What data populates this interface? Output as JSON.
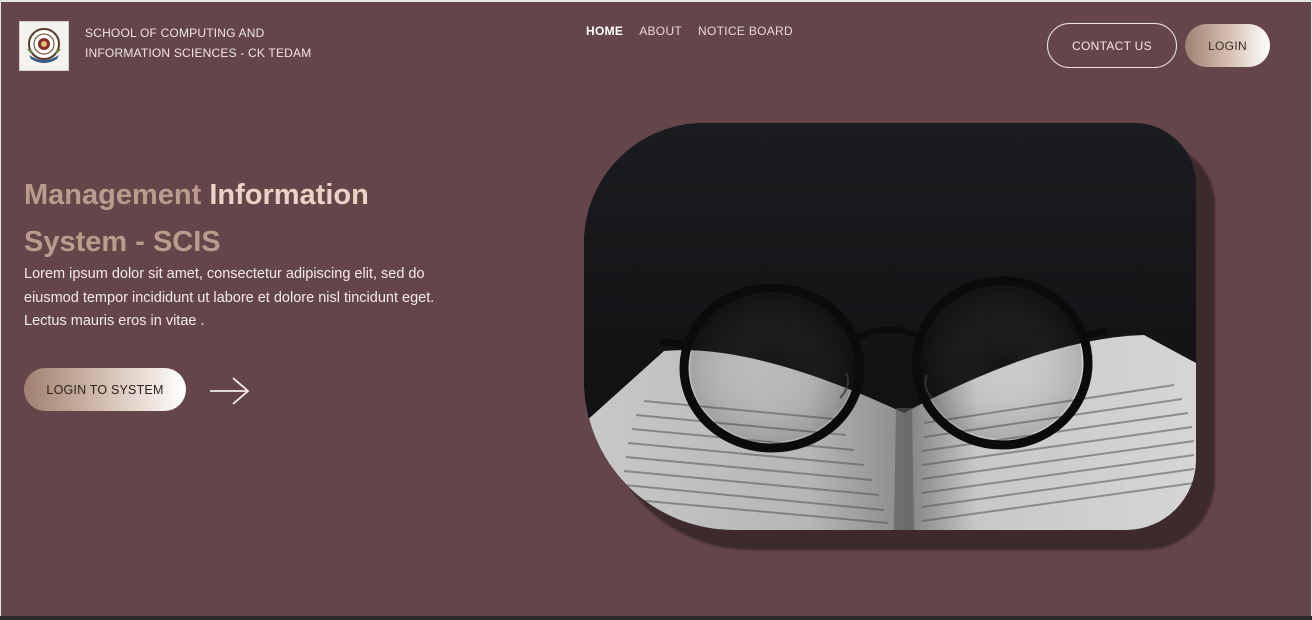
{
  "header": {
    "school_name_line1": "SCHOOL OF COMPUTING AND",
    "school_name_line2": "INFORMATION SCIENCES - CK TEDAM",
    "logo_icon": "school-crest"
  },
  "nav": {
    "items": [
      {
        "label": "HOME",
        "active": true
      },
      {
        "label": "ABOUT",
        "active": false
      },
      {
        "label": "NOTICE BOARD",
        "active": false
      }
    ]
  },
  "actions": {
    "contact_label": "CONTACT US",
    "login_label": "LOGIN"
  },
  "hero": {
    "title_part1": "Management",
    "title_part2": "Information",
    "title_part3": "System - SCIS",
    "description": "Lorem ipsum dolor sit amet, consectetur adipiscing elit, sed do eiusmod tempor incididunt ut labore et dolore nisl tincidunt eget. Lectus mauris eros in vitae .",
    "cta_label": "LOGIN TO SYSTEM",
    "cta_icon": "arrow-right-icon",
    "image_icon": "glasses-on-book-photo"
  },
  "colors": {
    "background": "#64464a",
    "accent_gradient_start": "#a08070",
    "accent_gradient_end": "#ffffff",
    "title": "#c2a190"
  }
}
